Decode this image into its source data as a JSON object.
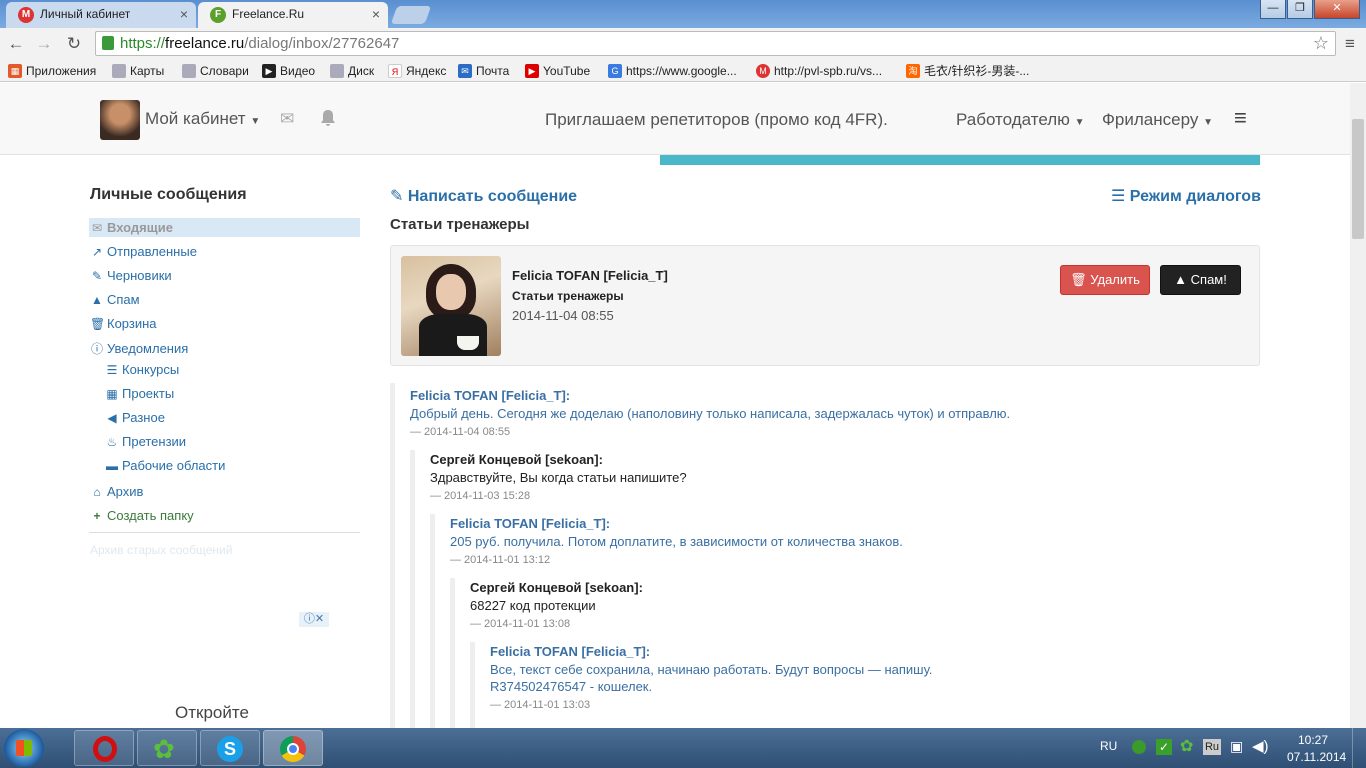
{
  "browser": {
    "tabs": [
      {
        "title": "Личный кабинет",
        "icon": "М"
      },
      {
        "title": "Freelance.Ru",
        "icon": "F"
      }
    ],
    "url_scheme": "https://",
    "url_host": "freelance.ru",
    "url_path": "/dialog/inbox/27762647",
    "bookmarks": [
      "Приложения",
      "Карты",
      "Словари",
      "Видео",
      "Диск",
      "Яндекс",
      "Почта",
      "YouTube",
      "https://www.google...",
      "http://pvl-spb.ru/vs...",
      "毛衣/针织衫-男装-..."
    ]
  },
  "header": {
    "cabinet": "Мой кабинет",
    "promo": "Приглашаем репетиторов (промо код 4FR).",
    "employer": "Работодателю",
    "freelancer": "Фрилансеру"
  },
  "sidebar": {
    "title": "Личные сообщения",
    "items": [
      "Входящие",
      "Отправленные",
      "Черновики",
      "Спам",
      "Корзина",
      "Уведомления"
    ],
    "subitems": [
      "Конкурсы",
      "Проекты",
      "Разное",
      "Претензии",
      "Рабочие области"
    ],
    "archive": "Архив",
    "create_folder": "Создать папку",
    "old_archive": "Архив старых сообщений",
    "ad_text": "Откройте"
  },
  "main": {
    "write": "Написать сообщение",
    "dialog_mode": "Режим диалогов",
    "subject": "Статьи тренажеры",
    "card": {
      "name": "Felicia TOFAN [Felicia_T]",
      "subject": "Статьи тренажеры",
      "date": "2014-11-04 08:55",
      "delete": "Удалить",
      "spam": "Спам!"
    },
    "messages": [
      {
        "author": "Felicia TOFAN [Felicia_T]:",
        "text": "Добрый день. Сегодня же доделаю (наполовину только написала, задержалась чуток) и отправлю.",
        "time": "— 2014-11-04 08:55"
      },
      {
        "author": "Сергей Концевой [sekoan]:",
        "text": "Здравствуйте, Вы когда статьи напишите?",
        "time": "— 2014-11-03 15:28"
      },
      {
        "author": "Felicia TOFAN [Felicia_T]:",
        "text": "205 руб. получила. Потом доплатите, в зависимости от количества знаков.",
        "time": "— 2014-11-01 13:12"
      },
      {
        "author": "Сергей Концевой [sekoan]:",
        "text": "68227 код протекции",
        "time": "— 2014-11-01 13:08"
      },
      {
        "author": "Felicia TOFAN [Felicia_T]:",
        "text": "Все, текст себе сохранила, начинаю работать. Будут вопросы — напишу.",
        "text2": "R374502476547 - кошелек.",
        "time": "— 2014-11-01 13:03"
      }
    ]
  },
  "taskbar": {
    "lang": "RU",
    "time": "10:27",
    "date": "07.11.2014",
    "tray_lang": "Ru"
  }
}
